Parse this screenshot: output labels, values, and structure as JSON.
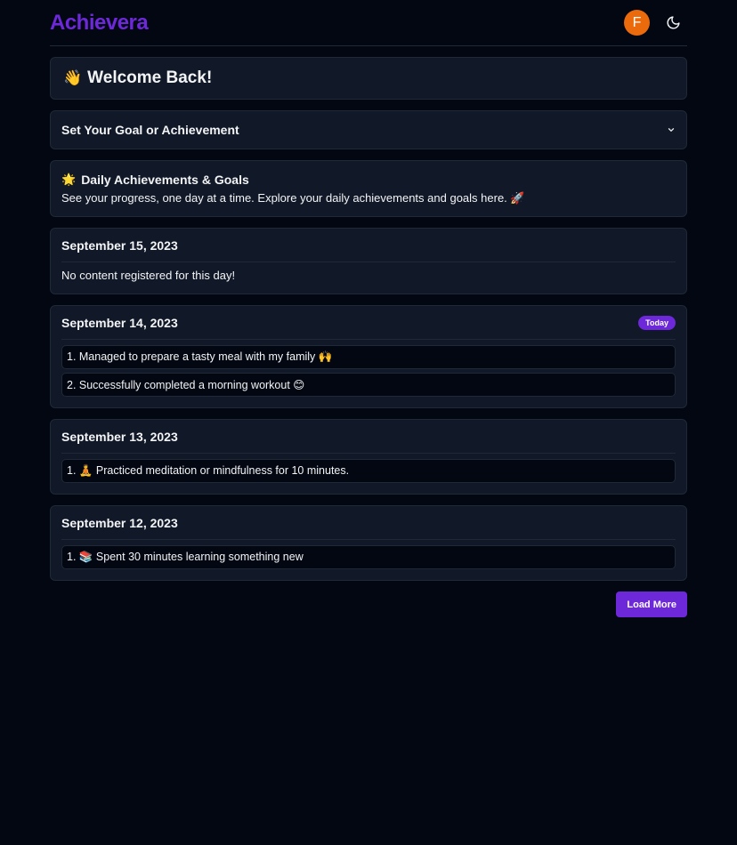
{
  "app": {
    "title": "Achievera"
  },
  "header": {
    "avatar_initial": "F",
    "avatar_color": "#ea6a0c",
    "theme_toggle_icon": "moon-icon"
  },
  "welcome": {
    "emoji": "👋",
    "title": "Welcome Back!"
  },
  "goal_setter": {
    "label": "Set Your Goal or Achievement",
    "icon": "chevron-down-icon"
  },
  "daily": {
    "emoji": "🌟",
    "title": "Daily Achievements & Goals",
    "description": "See your progress, one day at a time. Explore your daily achievements and goals here. 🚀"
  },
  "days": [
    {
      "date": "September 15, 2023",
      "badge": null,
      "empty_text": "No content registered for this day!",
      "items": []
    },
    {
      "date": "September 14, 2023",
      "badge": "Today",
      "items": [
        "1. Managed to prepare a tasty meal with my family 🙌",
        "2. Successfully completed a morning workout 😊"
      ]
    },
    {
      "date": "September 13, 2023",
      "badge": null,
      "items": [
        "1. 🧘 Practiced meditation or mindfulness for 10 minutes."
      ]
    },
    {
      "date": "September 12, 2023",
      "badge": null,
      "items": [
        "1. 📚 Spent 30 minutes learning something new"
      ]
    }
  ],
  "actions": {
    "load_more": "Load More"
  },
  "colors": {
    "accent": "#6d28d9",
    "background": "#030712",
    "card": "#111827",
    "border": "#1f2937"
  }
}
